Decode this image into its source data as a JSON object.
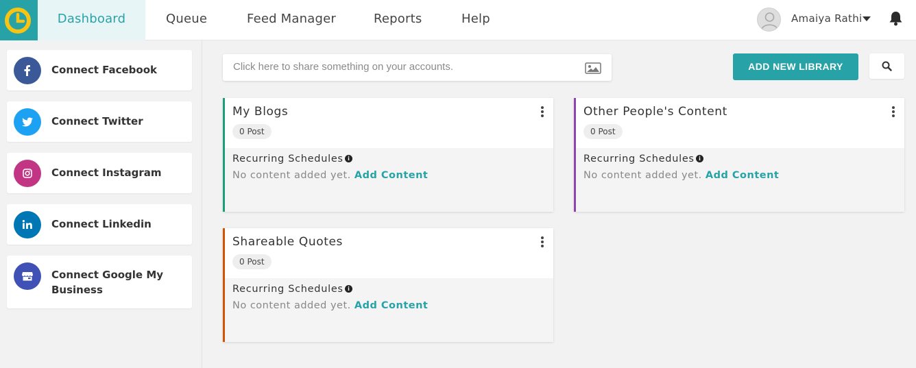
{
  "nav": {
    "items": [
      {
        "label": "Dashboard",
        "active": true
      },
      {
        "label": "Queue"
      },
      {
        "label": "Feed Manager"
      },
      {
        "label": "Reports"
      },
      {
        "label": "Help"
      }
    ],
    "user_name": "Amaiya Rathi",
    "accent_color": "#27a3a8"
  },
  "sidebar": {
    "items": [
      {
        "label": "Connect Facebook",
        "icon": "facebook-icon",
        "color": "#3b5998"
      },
      {
        "label": "Connect Twitter",
        "icon": "twitter-icon",
        "color": "#1da1f2"
      },
      {
        "label": "Connect Instagram",
        "icon": "instagram-icon",
        "color": "#c13584"
      },
      {
        "label": "Connect Linkedin",
        "icon": "linkedin-icon",
        "color": "#0077b5"
      },
      {
        "label": "Connect Google My Business",
        "icon": "google-my-business-icon",
        "color": "#3f51b5"
      }
    ]
  },
  "toolbar": {
    "share_placeholder": "Click here to share something on your accounts.",
    "add_library_label": "ADD NEW LIBRARY"
  },
  "libraries": [
    {
      "title": "My Blogs",
      "posts": "0 Post",
      "recurring_label": "Recurring Schedules",
      "empty_text": "No content added yet.",
      "add_content": "Add Content",
      "color": "#1a9e7b"
    },
    {
      "title": "Other People's Content",
      "posts": "0 Post",
      "recurring_label": "Recurring Schedules",
      "empty_text": "No content added yet.",
      "add_content": "Add Content",
      "color": "#8e44ad"
    },
    {
      "title": "Shareable Quotes",
      "posts": "0 Post",
      "recurring_label": "Recurring Schedules",
      "empty_text": "No content added yet.",
      "add_content": "Add Content",
      "color": "#d35400"
    }
  ]
}
